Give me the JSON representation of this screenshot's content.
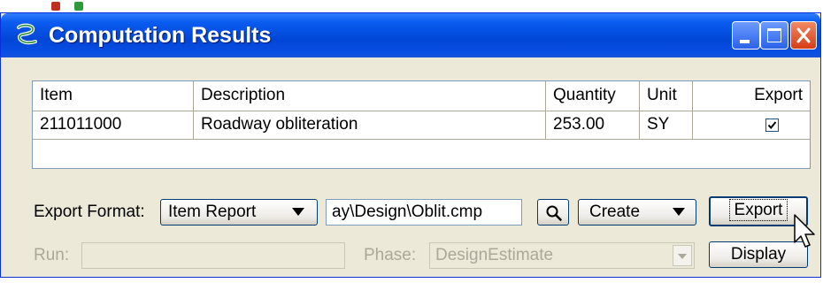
{
  "window": {
    "title": "Computation Results"
  },
  "grid": {
    "columns": [
      "Item",
      "Description",
      "Quantity",
      "Unit",
      "Export"
    ],
    "rows": [
      {
        "item": "211011000",
        "description": "Roadway obliteration",
        "quantity": "253.00",
        "unit": "SY",
        "export": true
      }
    ]
  },
  "export": {
    "format_label": "Export Format:",
    "format_value": "Item Report",
    "path_value": "ay\\Design\\Oblit.cmp",
    "create_label": "Create",
    "export_button": "Export"
  },
  "run": {
    "label": "Run:",
    "value": ""
  },
  "phase": {
    "label": "Phase:",
    "value": "DesignEstimate"
  },
  "display_button": "Display",
  "colors": {
    "title_bar": "#0a5cf0",
    "close_button": "#d63c16",
    "face": "#ece9d8"
  }
}
